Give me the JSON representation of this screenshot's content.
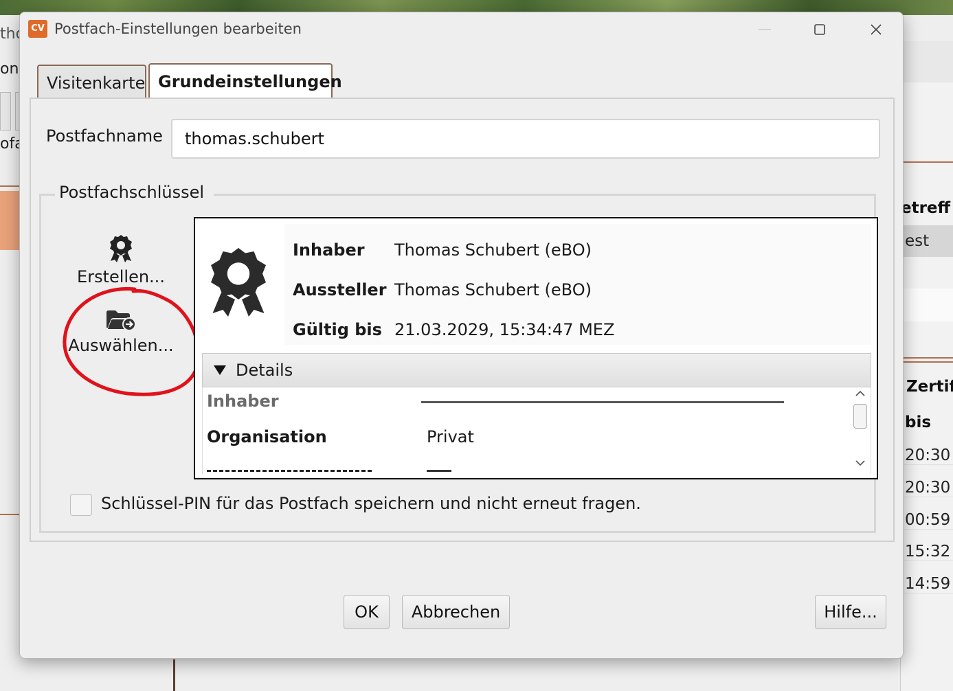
{
  "background": {
    "left_fragments": [
      "tho",
      "on",
      "ofa"
    ],
    "right_panel": {
      "header_1": "etreff",
      "value_1": "est",
      "header_2": "Zertif",
      "header_3": "bis",
      "times": [
        "20:30",
        "20:30",
        "00:59",
        "15:32",
        "14:59"
      ]
    }
  },
  "dialog": {
    "app_logo": "CV",
    "title": "Postfach-Einstellungen bearbeiten",
    "controls": {
      "minimize": "—",
      "maximize": "☐",
      "close": "✕"
    }
  },
  "tabs": [
    {
      "label": "Visitenkarte",
      "active": false
    },
    {
      "label": "Grundeinstellungen",
      "active": true
    }
  ],
  "form": {
    "postfachname_label": "Postfachname",
    "postfachname_value": "thomas.schubert",
    "key_group_legend": "Postfachschlüssel",
    "create_label": "Erstellen...",
    "select_label": "Auswählen...",
    "annotation_color": "#e0121b"
  },
  "certificate": {
    "inhaber_key": "Inhaber",
    "inhaber_value": "Thomas Schubert (eBO)",
    "aussteller_key": "Aussteller",
    "aussteller_value": "Thomas Schubert (eBO)",
    "gueltig_key": "Gültig bis",
    "gueltig_value": "21.03.2029, 15:34:47 MEZ",
    "details_label": "Details",
    "details_rows": [
      {
        "key": "Inhaber",
        "value": ""
      },
      {
        "key": "Organisation",
        "value": "Privat"
      }
    ]
  },
  "pin_label": "Schlüssel-PIN für das Postfach speichern und nicht erneut fragen.",
  "pin_checked": false,
  "buttons": {
    "ok": "OK",
    "cancel": "Abbrechen",
    "help": "Hilfe..."
  }
}
